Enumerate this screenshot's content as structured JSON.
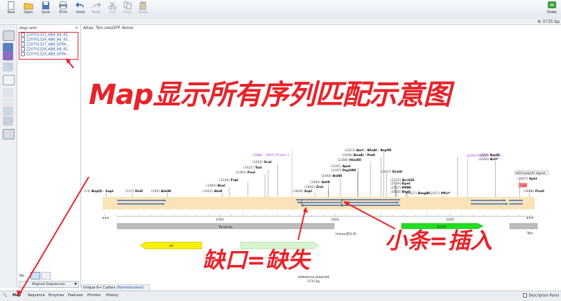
{
  "toolbar": {
    "buttons": [
      {
        "label": "New",
        "enabled": true
      },
      {
        "label": "Open",
        "enabled": true
      },
      {
        "label": "Save",
        "enabled": true
      },
      {
        "label": "Print",
        "enabled": true
      },
      {
        "label": "Undo",
        "enabled": true
      },
      {
        "label": "Redo",
        "enabled": false
      },
      {
        "label": "Cut",
        "enabled": false
      },
      {
        "label": "Copy",
        "enabled": false
      },
      {
        "label": "Paste",
        "enabled": false
      }
    ],
    "order_label": "Order"
  },
  "sequence_length": "3735 bp",
  "align_panel": {
    "title": "Align with:",
    "close": "×",
    "sequences": [
      "Z20701322_AB4_A4_45...",
      "Z20701326_AB6_A6_45...",
      "Z20701327_AB8_GFPA-...",
      "Z20701328_AB8_A8_45...",
      "Z20701329_AB9_GFPA-..."
    ],
    "no_label": "No",
    "aligned_select": "Aligned Sequences"
  },
  "map": {
    "alias": "Alias: Tori-iresGFP donor",
    "enzymes": [
      {
        "pos": "(13)",
        "name": "BspQI - SapI"
      },
      {
        "pos": "(237)",
        "name": "DrdI"
      },
      {
        "pos": "(546)",
        "name": "AlwNI"
      },
      {
        "pos": "(1022)",
        "name": "AhdI"
      },
      {
        "pos": "(1083)",
        "name": "BsaI"
      },
      {
        "pos": "(1244)",
        "name": "FspI"
      },
      {
        "pos": "(1392)",
        "name": "PvuI"
      },
      {
        "pos": "(1421)",
        "name": "TssI"
      },
      {
        "pos": "(1502)",
        "name": "ScaI"
      },
      {
        "pos": "(1826)",
        "name": "SspI"
      },
      {
        "pos": "(1942)",
        "name": "ZraI"
      },
      {
        "pos": "(1944)",
        "name": "AatII"
      },
      {
        "pos": "(2048)",
        "name": "BstBI"
      },
      {
        "pos": "(2197)",
        "name": "PspOMI"
      },
      {
        "pos": "(2201)",
        "name": "ApaI"
      },
      {
        "pos": "(2308)",
        "name": "HindIII"
      },
      {
        "pos": "(2400)",
        "name": "BsaAI - PmlI"
      },
      {
        "pos": "(2423)",
        "name": "AarI - BfuAI - BspMI"
      },
      {
        "pos": "(2447)",
        "name": "DraIII"
      },
      {
        "pos": "(2525)",
        "name": "AccGSI"
      },
      {
        "pos": "(2529)",
        "name": "KpnI"
      },
      {
        "pos": "(2537)",
        "name": "PflMI"
      },
      {
        "pos": "(2618)",
        "name": "BlgII"
      },
      {
        "pos": "(2627)",
        "name": "BmgBI"
      },
      {
        "pos": "(2937)",
        "name": "PflcI*"
      },
      {
        "pos": "(3066)",
        "name": "BsrGI"
      },
      {
        "pos": "(3394)",
        "name": "BclI*"
      },
      {
        "pos": "(3607)",
        "name": "SphI"
      },
      {
        "pos": "(3688)",
        "name": "PvuII"
      }
    ],
    "primer1": "(1988 .. 2007) Primer 1",
    "gfpa": "GFPA-F (3247 .. 3267)",
    "bgh": "bGH poly(A) signal",
    "fam": "FAM",
    "scale": [
      "1000",
      "2000",
      "3000"
    ],
    "feature_toriamp": "Toriamp",
    "feature_intron": "Intron(E3-4)",
    "feature_ori": "ori",
    "feature_tori": "Tori",
    "feature_egfp": "EGFP",
    "plasmid_name": "reference plasmid",
    "plasmid_len": "3735 bp",
    "ellipsis": "..."
  },
  "overlays": {
    "title": "Map显示所有序列匹配示意图",
    "gap": "缺口=缺失",
    "insert": "小条=插入"
  },
  "cutters_tab": {
    "label": "Unique 6+ Cutters",
    "mode": "(Nonredundant)"
  },
  "status_tabs": [
    "Map",
    "Sequence",
    "Enzymes",
    "Features",
    "Primers",
    "History"
  ],
  "description_panel": "Description Panel",
  "colors": {
    "annotation": "#e8232a",
    "aligned_read": "#3d6db5",
    "primer": "#a040e0",
    "backbone": "#fbe3b8",
    "toriamp": "#bdbdbd",
    "ori": "#f7f000",
    "egfp": "#22dd22"
  }
}
